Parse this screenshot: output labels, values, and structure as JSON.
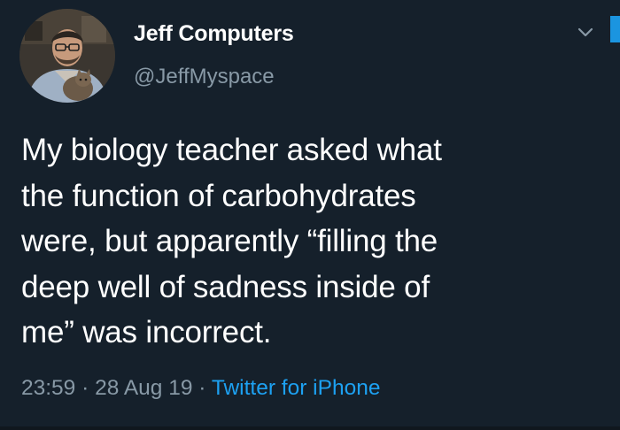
{
  "author": {
    "display_name": "Jeff Computers",
    "handle": "@JeffMyspace",
    "avatar_alt": "profile photo"
  },
  "tweet": {
    "lines": [
      "My biology teacher asked what",
      "the function of carbohydrates",
      "were, but apparently “filling the",
      "deep well of sadness inside of",
      "me” was incorrect."
    ]
  },
  "meta": {
    "time": "23:59",
    "separator": "·",
    "date": "28 Aug 19",
    "source": "Twitter for iPhone"
  },
  "icons": {
    "menu": "chevron-down-icon"
  },
  "colors": {
    "background": "#15202b",
    "primary_text": "#ffffff",
    "secondary_text": "#8899a6",
    "accent": "#1da1f2"
  }
}
